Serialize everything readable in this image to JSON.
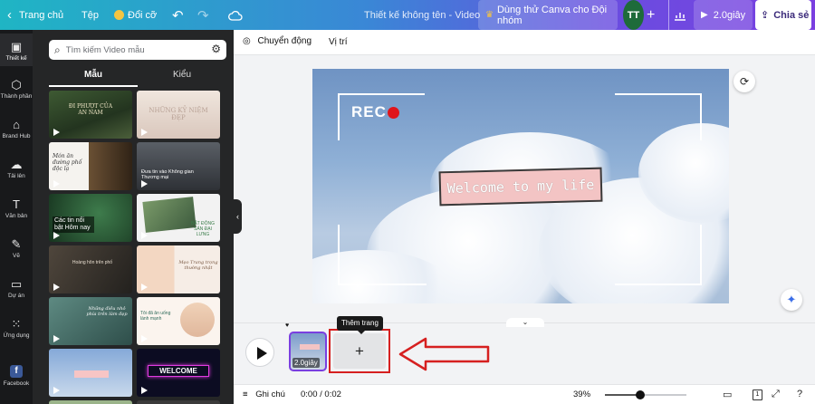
{
  "topbar": {
    "home_label": "Trang chủ",
    "file_label": "Tệp",
    "resize_label": "Đổi cỡ",
    "undo_icon": "undo-icon",
    "redo_icon": "redo-icon",
    "cloud_icon": "cloud-save-icon",
    "design_title": "Thiết kế không tên - Video",
    "trial_label": "Dùng thử Canva cho Đội nhóm",
    "avatar_initials": "TT",
    "present_label": "2.0giây",
    "share_label": "Chia sẻ",
    "gradient_colors": [
      "#1fb5c4",
      "#3a87d6",
      "#7a3fe0"
    ]
  },
  "rail": {
    "items": [
      {
        "label": "Thiết kế",
        "icon": "layout-icon"
      },
      {
        "label": "Thành phần",
        "icon": "elements-icon"
      },
      {
        "label": "Brand Hub",
        "icon": "brand-icon"
      },
      {
        "label": "Tải lên",
        "icon": "upload-icon"
      },
      {
        "label": "Văn bản",
        "icon": "text-icon"
      },
      {
        "label": "Vẽ",
        "icon": "draw-icon"
      },
      {
        "label": "Dự án",
        "icon": "folder-icon"
      },
      {
        "label": "Ứng dụng",
        "icon": "apps-icon"
      },
      {
        "label": "Facebook",
        "icon": "facebook-icon"
      }
    ]
  },
  "panel": {
    "search_placeholder": "Tìm kiếm Video mẫu",
    "tabs": [
      {
        "label": "Mẫu"
      },
      {
        "label": "Kiểu"
      }
    ],
    "thumbnails": [
      {
        "title": "ĐI PHƯỢT CỦA AN NAM"
      },
      {
        "title": "NHỮNG KỶ NIỆM ĐẸP"
      },
      {
        "title": "Món ăn đường phố độc lạ"
      },
      {
        "title": "Đưa tin vào Không gian Thương mại"
      },
      {
        "title": "Các tin nổi bật Hôm nay"
      },
      {
        "title": "BẤT ĐỘNG SẢN ĐẠI LƯNG"
      },
      {
        "title": "Hoàng hôn trên phố"
      },
      {
        "title": "Mẹo Trang trọng thường nhật"
      },
      {
        "title": "Những điều nhỏ phía trên làm đẹp"
      },
      {
        "title": "Tôi đã ăn uống lành mạnh"
      },
      {
        "title": ""
      },
      {
        "title": "WELCOME"
      }
    ]
  },
  "context_toolbar": {
    "animate_label": "Chuyển động",
    "position_label": "Vị trí"
  },
  "canvas": {
    "rec_label": "REC",
    "welcome_text": "Welcome to my life",
    "rec_dot_color": "#e0151b",
    "pill_color": "#f3c4c4"
  },
  "timeline": {
    "scene_duration": "2.0giây",
    "add_page_symbol": "+",
    "tooltip": "Thêm trang"
  },
  "bottombar": {
    "notes_label": "Ghi chú",
    "time": "0:00 / 0:02",
    "zoom": "39%",
    "zoom_fraction": 0.39,
    "page_count": "1"
  }
}
